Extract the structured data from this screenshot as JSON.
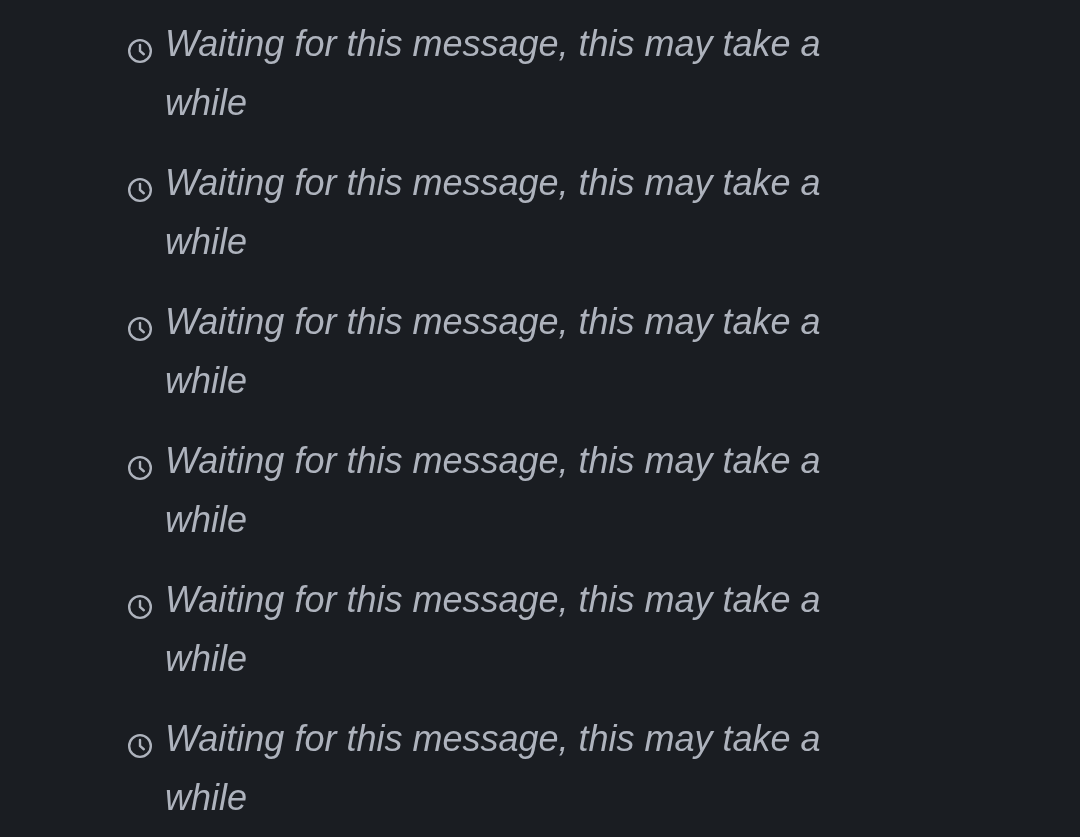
{
  "messages": [
    {
      "kind": "pending",
      "text": "Waiting for this message, this may take a while"
    },
    {
      "kind": "pending",
      "text": "Waiting for this message, this may take a while"
    },
    {
      "kind": "pending",
      "text": "Waiting for this message, this may take a while"
    },
    {
      "kind": "pending",
      "text": "Waiting for this message, this may take a while"
    },
    {
      "kind": "pending",
      "text": "Waiting for this message, this may take a while"
    },
    {
      "kind": "pending",
      "text": "Waiting for this message, this may take a while"
    }
  ]
}
